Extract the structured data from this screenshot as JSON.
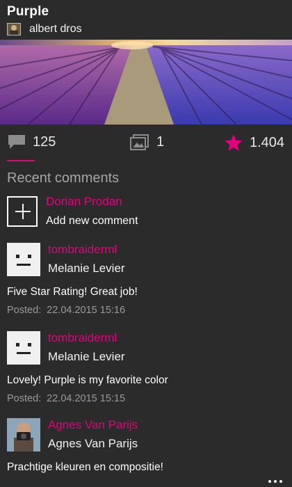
{
  "photo": {
    "title": "Purple",
    "author": "albert dros"
  },
  "stats": {
    "comments": "125",
    "galleries": "1",
    "favorites": "1.404",
    "accent": "#e5007e"
  },
  "comments_section": {
    "title": "Recent comments",
    "add": {
      "user": "Dorian Prodan",
      "label": "Add new comment"
    },
    "items": [
      {
        "username": "tombraiderml",
        "name": "Melanie Levier",
        "text": "Five Star Rating! Great job!",
        "posted_label": "Posted:",
        "posted": "22.04.2015 15:16"
      },
      {
        "username": "tombraiderml",
        "name": "Melanie Levier",
        "text": "Lovely! Purple is my favorite color",
        "posted_label": "Posted:",
        "posted": "22.04.2015 15:15"
      },
      {
        "username": "Agnes Van Parijs",
        "name": "Agnes Van Parijs",
        "text": "Prachtige kleuren en compositie!"
      }
    ]
  },
  "icons": [
    "comment-icon",
    "image-icon",
    "star-icon",
    "add-icon",
    "more-icon"
  ]
}
